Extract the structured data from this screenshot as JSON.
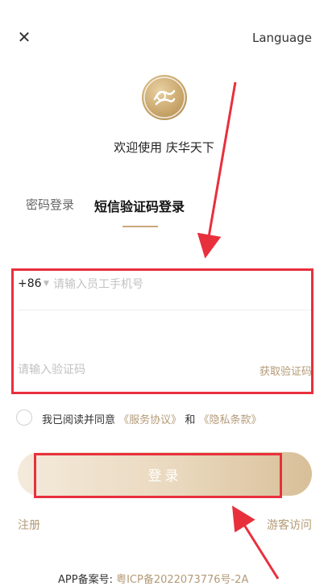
{
  "header": {
    "close_icon": "close-icon",
    "language_label": "Language"
  },
  "logo": {
    "icon": "brand-logo"
  },
  "welcome_text": "欢迎使用 庆华天下",
  "tabs": [
    {
      "label": "密码登录",
      "active": false
    },
    {
      "label": "短信验证码登录",
      "active": true
    }
  ],
  "form": {
    "country_code": "+86",
    "phone_placeholder": "请输入员工手机号",
    "code_placeholder": "请输入验证码",
    "get_code_label": "获取验证码"
  },
  "agreement": {
    "prefix": "我已阅读并同意",
    "service_link": "《服务协议》",
    "and": "和",
    "privacy_link": "《隐私条款》",
    "checked": false
  },
  "login_label": "登录",
  "footer": {
    "register_label": "注册",
    "guest_label": "游客访问",
    "icp_prefix": "APP备案号:",
    "icp_number": "粤ICP备2022073776号-2A"
  },
  "colors": {
    "accent": "#b49a77",
    "annotation_red": "#e8303d",
    "button_gradient_end": "#d8bf98"
  }
}
